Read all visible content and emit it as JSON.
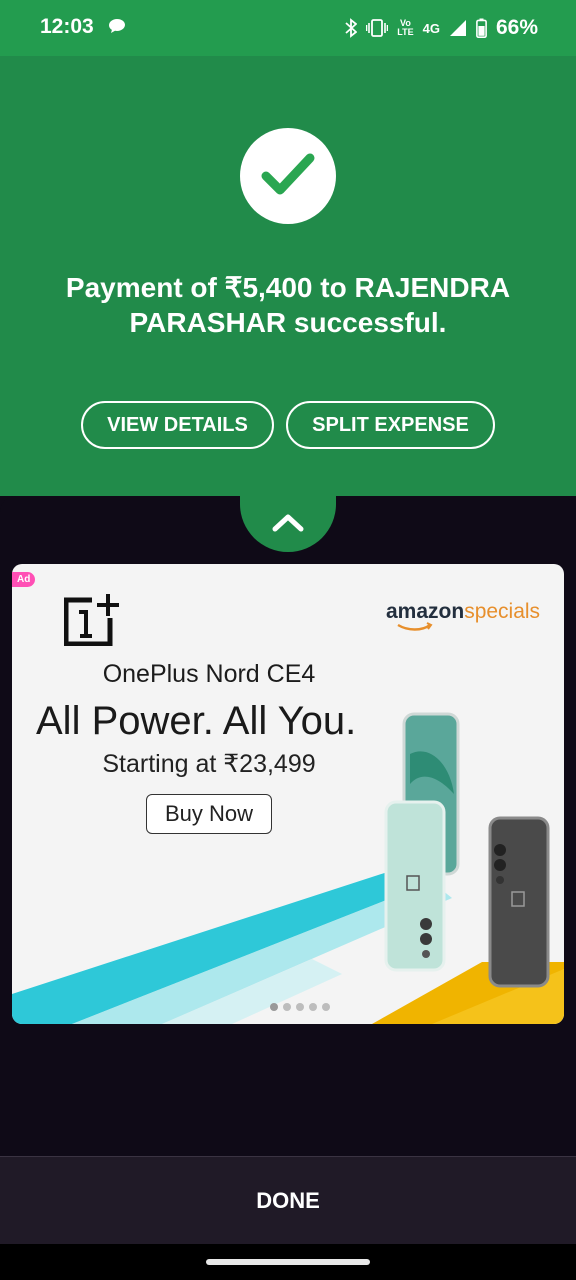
{
  "status_bar": {
    "time": "12:03",
    "battery": "66%",
    "network": "4G",
    "volte_top": "Vo",
    "volte_bottom": "LTE",
    "icons": [
      "chat-icon",
      "bluetooth-icon",
      "vibrate-icon",
      "volte-icon",
      "signal-icon",
      "battery-icon"
    ]
  },
  "payment": {
    "message": "Payment of ₹5,400 to RAJENDRA PARASHAR successful.",
    "status_icon": "check-icon"
  },
  "actions": {
    "view_details": "VIEW DETAILS",
    "split_expense": "SPLIT EXPENSE"
  },
  "sheet": {
    "expand_icon": "chevron-up-icon"
  },
  "ad": {
    "badge": "Ad",
    "brand_logo": "oneplus-logo",
    "sponsor_brand": "amazon",
    "sponsor_suffix": "specials",
    "model": "OnePlus Nord CE4",
    "headline": "All Power. All You.",
    "price": "Starting at ₹23,499",
    "cta": "Buy Now",
    "carousel": {
      "total": 5,
      "active": 1
    }
  },
  "footer": {
    "done_label": "DONE"
  },
  "colors": {
    "status_green": "#239c4f",
    "hero_green": "#218b4a",
    "check_green": "#2aa651",
    "sheet_bg": "#0f0a17",
    "footer_bg": "#201a27",
    "ad_badge": "#ff4fb5"
  }
}
